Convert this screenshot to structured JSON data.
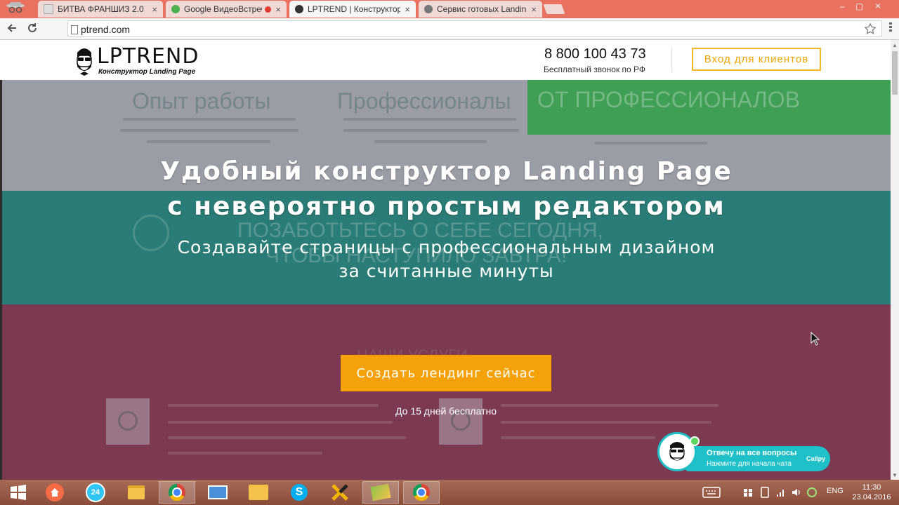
{
  "browser": {
    "tabs": [
      {
        "title": "БИТВА ФРАНШИЗ 2.0",
        "favicon_color": "#cccccc",
        "active": false
      },
      {
        "title": "Google ВидеоВстречи",
        "favicon_color": "#4caf50",
        "active": false
      },
      {
        "title": "LPTREND | Конструктор л",
        "favicon_color": "#333333",
        "active": true
      },
      {
        "title": "Сервис готовых Landing",
        "favicon_color": "#666666",
        "active": false
      }
    ],
    "close_glyph": "×",
    "url": "lptrend.com",
    "url_prefix_partial": "ptrend.com",
    "window_controls": [
      "–",
      "▢",
      "×"
    ],
    "nav_icons": [
      "arrow-left-icon",
      "reload-icon"
    ]
  },
  "site_header": {
    "logo_title": "LPTREND",
    "logo_subtitle": "Конструктор Landing Page",
    "phone": "8 800 100 43 73",
    "phone_note": "Бесплатный звонок по РФ",
    "login_button": "Вход для клиентов",
    "accent_color": "#f5b729"
  },
  "hero": {
    "title_line1": "Удобный конструктор Landing Page",
    "title_line2": "с невероятно простым редактором",
    "subtitle_line1": "Создавайте страницы с профессиональным дизайном",
    "subtitle_line2": "за считанные минуты",
    "cta_button": "Создать лендинг сейчас",
    "cta_note": "До 15 дней бесплатно",
    "cta_color": "#f5a20a",
    "background_text": {
      "col1": "Опыт работы",
      "col2": "Профессионалы",
      "green_box": "ОТ ПРОФЕССИОНАЛОВ",
      "teal_line1": "ПОЗАБОТЬТЕСЬ О СЕБЕ СЕГОДНЯ,",
      "teal_line2": "ЧТОБЫ НАСТУПИЛО ЗАВТРА!",
      "services": "НАШИ УСЛУГИ"
    }
  },
  "chat_widget": {
    "line1": "Отвечу на все вопросы",
    "line2": "Нажмите для начала чата",
    "brand": "Callpy",
    "color": "#1fc0c8"
  },
  "taskbar": {
    "language": "ENG",
    "time": "11:30",
    "date": "23.04.2016",
    "apps": [
      "start",
      "home",
      "bitrix24",
      "explorer",
      "chrome",
      "snipping",
      "folder",
      "skype",
      "xmind",
      "gallery",
      "chrome"
    ]
  }
}
